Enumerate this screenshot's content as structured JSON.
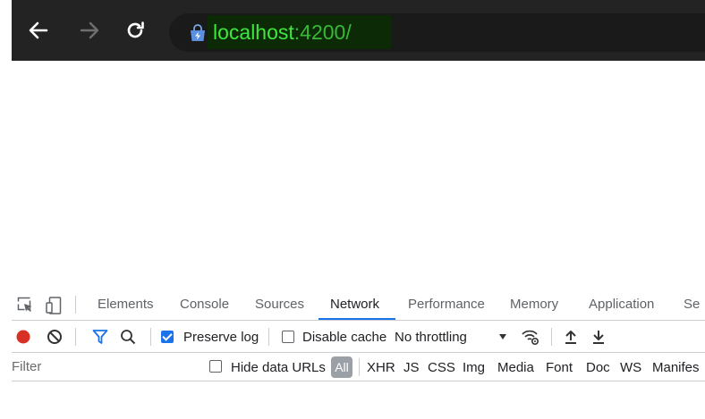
{
  "browser": {
    "url_host": "localhost",
    "url_port": ":4200/",
    "icons": [
      "back-arrow-icon",
      "forward-arrow-icon",
      "reload-icon",
      "site-info-icon"
    ]
  },
  "devtools": {
    "tabs": [
      "Elements",
      "Console",
      "Sources",
      "Network",
      "Performance",
      "Memory",
      "Application",
      "Se"
    ],
    "active_tab": "Network",
    "toolbar": {
      "preserve_log_label": "Preserve log",
      "preserve_log_checked": true,
      "disable_cache_label": "Disable cache",
      "disable_cache_checked": false,
      "throttling_value": "No throttling"
    },
    "filter": {
      "placeholder": "Filter",
      "hide_data_urls_label": "Hide data URLs",
      "types": [
        "All",
        "XHR",
        "JS",
        "CSS",
        "Img",
        "Media",
        "Font",
        "Doc",
        "WS",
        "Manifes"
      ],
      "active_type": "All"
    },
    "colors": {
      "record": "#d93025",
      "accent": "#1a73e8"
    }
  }
}
